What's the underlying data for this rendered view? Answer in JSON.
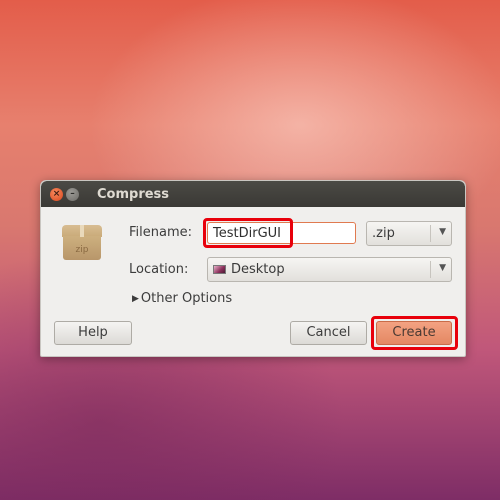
{
  "window": {
    "title": "Compress",
    "close_glyph": "×",
    "minimize_glyph": "–"
  },
  "archive_icon": {
    "label": "zip",
    "icon": "archive-box-icon"
  },
  "form": {
    "filename_label": "Filename:",
    "filename_value": "TestDirGUI",
    "extension_selected": ".zip",
    "location_label": "Location:",
    "location_selected": "Desktop",
    "other_options_label": "Other Options",
    "dropdown_arrow": "▼",
    "expander_arrow": "▶"
  },
  "buttons": {
    "help": "Help",
    "cancel": "Cancel",
    "create": "Create"
  },
  "annotation_color": "#e8000b"
}
